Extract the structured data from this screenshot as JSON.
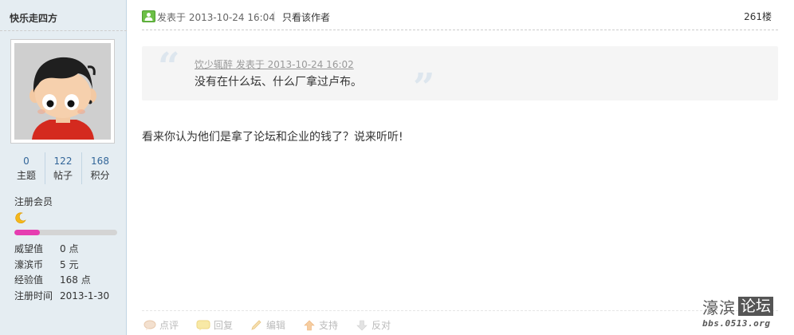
{
  "user": {
    "name": "快乐走四方",
    "stats": [
      {
        "value": "0",
        "label": "主题"
      },
      {
        "value": "122",
        "label": "帖子"
      },
      {
        "value": "168",
        "label": "积分"
      }
    ],
    "rank": "注册会员",
    "level_progress_fraction": 0.25,
    "info": [
      {
        "label": "威望值",
        "value": "0 点"
      },
      {
        "label": "濠滨币",
        "value": "5 元"
      },
      {
        "label": "经验值",
        "value": "168 点"
      },
      {
        "label": "注册时间",
        "value": "2013-1-30"
      }
    ]
  },
  "post": {
    "meta": "发表于 2013-10-24 16:04",
    "separator": "|",
    "author_only_label": "只看该作者",
    "floor": "261楼",
    "quote": {
      "meta": "饮少辄醉 发表于 2013-10-24 16:02",
      "text": "没有在什么坛、什么厂拿过卢布。"
    },
    "body": "看来你认为他们是拿了论坛和企业的钱了？说来听听!"
  },
  "actions": [
    {
      "name": "comment",
      "label": "点评",
      "icon": "comment-icon"
    },
    {
      "name": "reply",
      "label": "回复",
      "icon": "reply-icon"
    },
    {
      "name": "edit",
      "label": "编辑",
      "icon": "edit-icon"
    },
    {
      "name": "support",
      "label": "支持",
      "icon": "thumb-up-icon"
    },
    {
      "name": "oppose",
      "label": "反对",
      "icon": "thumb-down-icon"
    }
  ],
  "watermark": {
    "chinese": "濠滨",
    "boxed": "论坛",
    "url": "bbs.0513.org"
  },
  "colors": {
    "sidebar_bg": "#e5edf2",
    "link_blue": "#336699",
    "progress_fill": "#e63db1",
    "quote_bg": "#f5f5f5"
  }
}
